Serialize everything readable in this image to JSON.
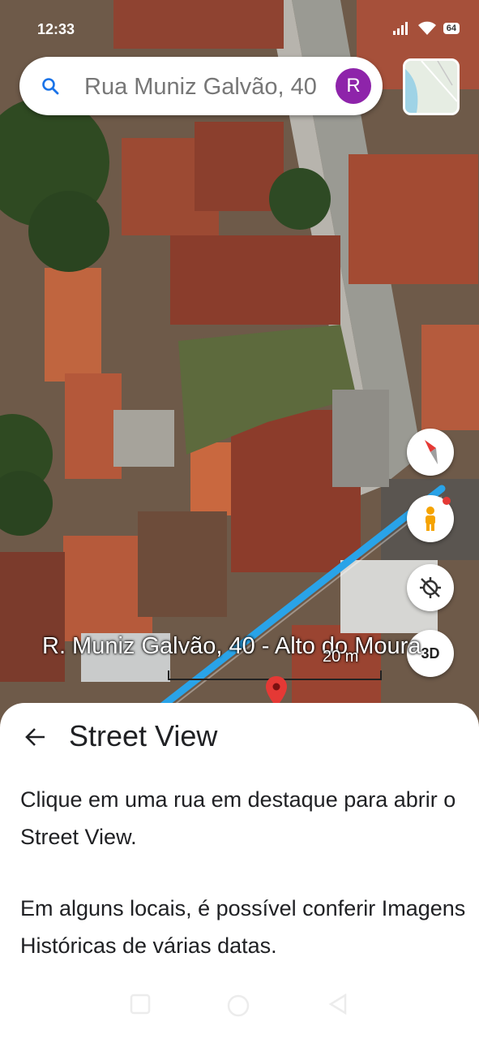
{
  "status_bar": {
    "time": "12:33",
    "battery": "64"
  },
  "search": {
    "text": "Rua Muniz Galvão, 40",
    "avatar_initial": "R"
  },
  "map": {
    "label": "R. Muniz Galvão, 40 - Alto do Moura",
    "scale": "20 m"
  },
  "controls": {
    "three_d": "3D"
  },
  "sheet": {
    "title": "Street View",
    "paragraph_1": "Clique em uma rua em destaque para abrir o Street View.",
    "paragraph_2": "Em alguns locais, é possível conferir Imagens Históricas de várias datas."
  },
  "colors": {
    "street_highlight": "#29a3e8",
    "avatar": "#8e24aa",
    "pin": "#e53935"
  }
}
